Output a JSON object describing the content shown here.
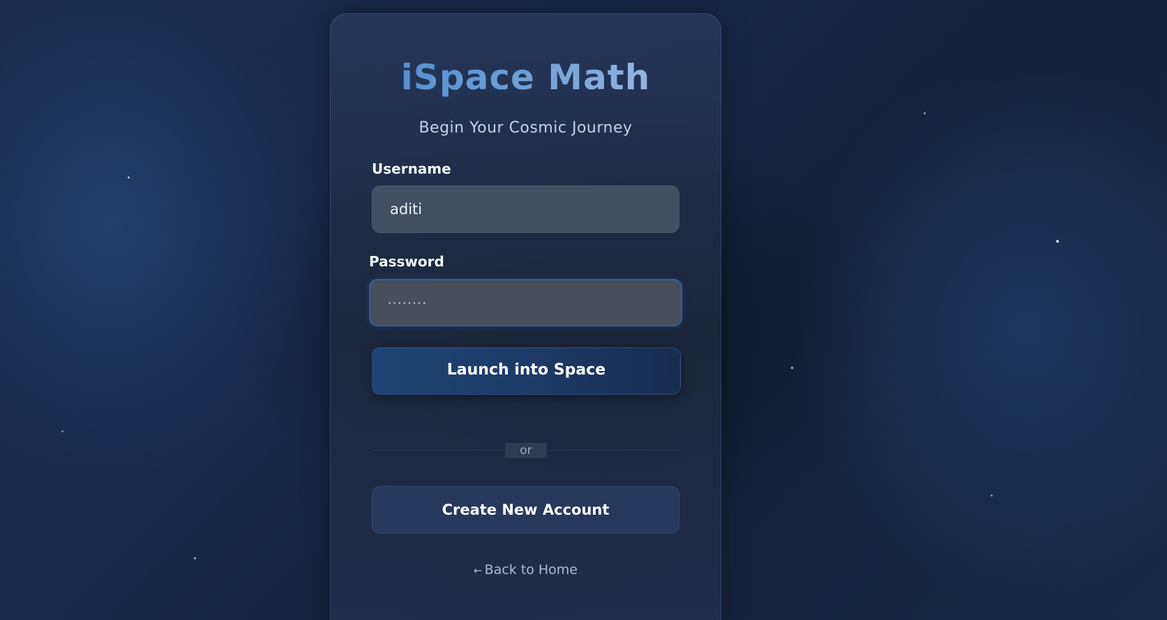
{
  "app": {
    "title": "iSpace Math",
    "subtitle": "Begin Your Cosmic Journey"
  },
  "form": {
    "username_label": "Username",
    "username_value": "aditi",
    "password_label": "Password",
    "password_value": "········",
    "submit_label": "Launch into Space"
  },
  "divider": {
    "text": "or"
  },
  "actions": {
    "create_account_label": "Create New Account",
    "back_arrow": "←",
    "back_label": "Back to Home"
  },
  "colors": {
    "background": "#17294a",
    "title_gradient_start": "#4a86cf",
    "title_gradient_end": "#a7c2e4",
    "primary_button": "#1f4474",
    "focus_border": "#2f5f9e"
  }
}
